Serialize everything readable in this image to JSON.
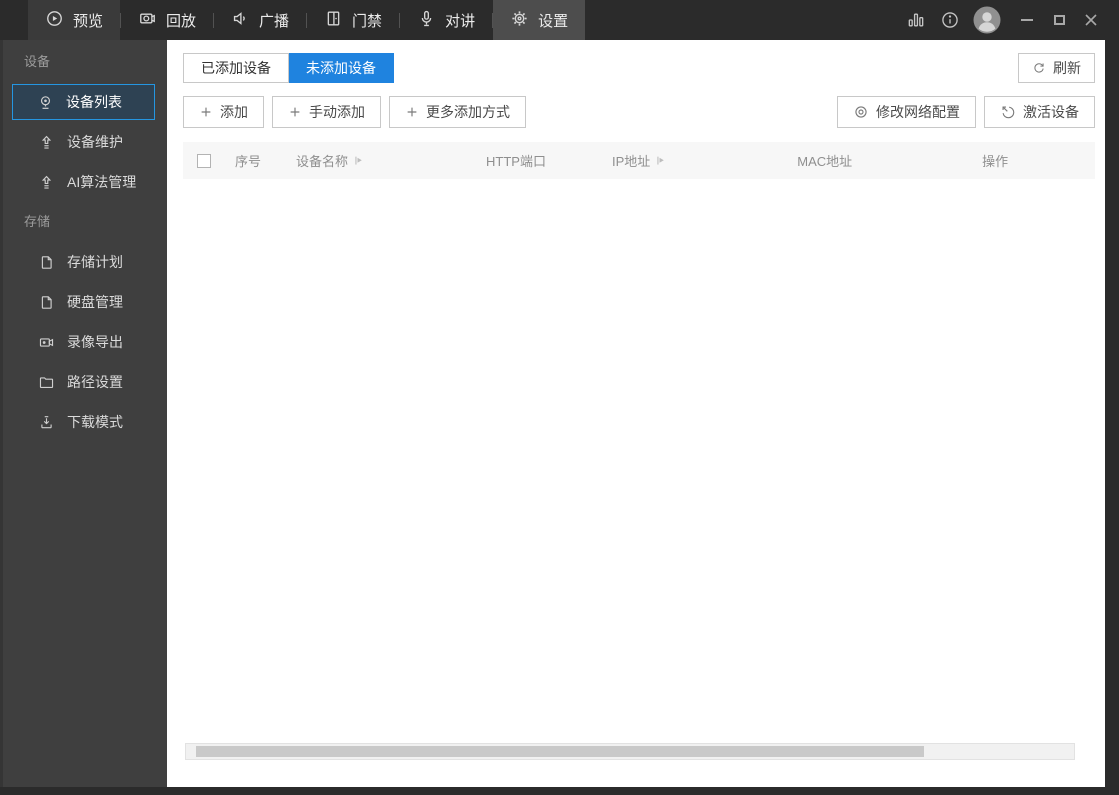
{
  "colors": {
    "accent_blue": "#1f83df",
    "selected_item_border": "#2596e1",
    "selected_item_bg": "#2e4253",
    "topbar_bg": "#2b2b2b",
    "topbar_active_bg": "#4d4d4d",
    "sidebar_bg": "#3f3f3f",
    "table_header_bg": "#f7f7f7"
  },
  "topbar": {
    "items": [
      {
        "label": "预览",
        "icon": "play-circle-icon"
      },
      {
        "label": "回放",
        "icon": "playback-camera-icon"
      },
      {
        "label": "广播",
        "icon": "speaker-icon"
      },
      {
        "label": "门禁",
        "icon": "door-icon"
      },
      {
        "label": "对讲",
        "icon": "microphone-icon"
      },
      {
        "label": "设置",
        "icon": "gear-icon"
      }
    ],
    "right_icons": [
      "stats-icon",
      "info-icon",
      "avatar"
    ],
    "window_controls": [
      "minimize",
      "maximize",
      "close"
    ]
  },
  "sidebar": {
    "sections": [
      {
        "title": "设备",
        "items": [
          {
            "label": "设备列表",
            "icon": "webcam-icon",
            "selected": true
          },
          {
            "label": "设备维护",
            "icon": "upgrade-arrow-icon",
            "selected": false
          },
          {
            "label": "AI算法管理",
            "icon": "upgrade-arrow-icon",
            "selected": false
          }
        ]
      },
      {
        "title": "存储",
        "items": [
          {
            "label": "存储计划",
            "icon": "storage-card-icon",
            "selected": false
          },
          {
            "label": "硬盘管理",
            "icon": "storage-card-icon",
            "selected": false
          },
          {
            "label": "录像导出",
            "icon": "video-camera-icon",
            "selected": false
          },
          {
            "label": "路径设置",
            "icon": "folder-icon",
            "selected": false
          },
          {
            "label": "下载模式",
            "icon": "download-icon",
            "selected": false
          }
        ]
      }
    ]
  },
  "main": {
    "tabs": [
      {
        "label": "已添加设备",
        "active": false
      },
      {
        "label": "未添加设备",
        "active": true
      }
    ],
    "refresh": {
      "label": "刷新",
      "icon": "refresh-icon"
    },
    "add_buttons": [
      {
        "label": "添加",
        "icon": "plus-icon"
      },
      {
        "label": "手动添加",
        "icon": "plus-icon"
      },
      {
        "label": "更多添加方式",
        "icon": "plus-icon"
      }
    ],
    "tool_buttons": [
      {
        "label": "修改网络配置",
        "icon": "bullseye-icon"
      },
      {
        "label": "激活设备",
        "icon": "activate-arrow-icon"
      }
    ],
    "table": {
      "columns": [
        {
          "label": "序号",
          "sortable": false
        },
        {
          "label": "设备名称",
          "sortable": true
        },
        {
          "label": "HTTP端口",
          "sortable": false
        },
        {
          "label": "IP地址",
          "sortable": true
        },
        {
          "label": "MAC地址",
          "sortable": false
        },
        {
          "label": "操作",
          "sortable": false
        }
      ],
      "rows": []
    }
  }
}
